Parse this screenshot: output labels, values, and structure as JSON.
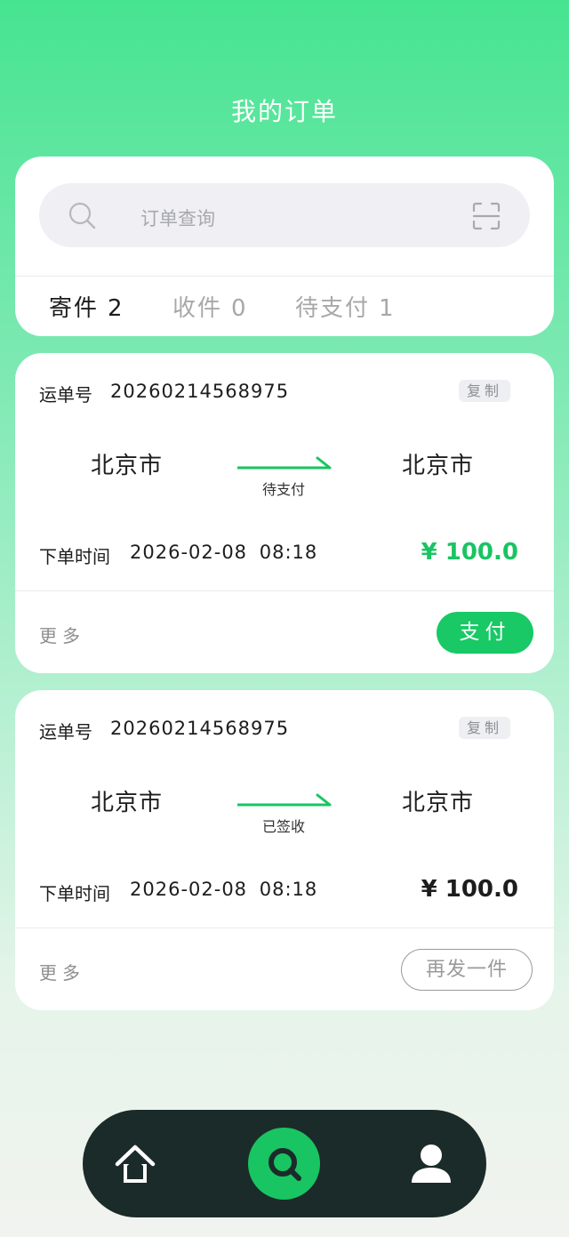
{
  "header": {
    "title": "我的订单"
  },
  "search": {
    "placeholder": "订单查询"
  },
  "tabs": [
    {
      "label": "寄件",
      "count": "2"
    },
    {
      "label": "收件",
      "count": "0"
    },
    {
      "label": "待支付",
      "count": "1"
    }
  ],
  "orders": [
    {
      "waybill_label": "运单号",
      "waybill_number": "20260214568975",
      "copy_label": "复制",
      "from_city": "北京市",
      "to_city": "北京市",
      "status": "待支付",
      "time_label": "下单时间",
      "time_value": "2026-02-08 08:18",
      "price": "¥ 100.0",
      "more_label": "更多",
      "action_label": "支付"
    },
    {
      "waybill_label": "运单号",
      "waybill_number": "20260214568975",
      "copy_label": "复制",
      "from_city": "北京市",
      "to_city": "北京市",
      "status": "已签收",
      "time_label": "下单时间",
      "time_value": "2026-02-08 08:18",
      "price": "¥ 100.0",
      "more_label": "更多",
      "action_label": "再发一件"
    }
  ],
  "nav": {
    "items": [
      {
        "icon": "home-icon"
      },
      {
        "icon": "search-icon"
      },
      {
        "icon": "user-icon"
      }
    ]
  },
  "colors": {
    "accent": "#19c462",
    "nav_background": "#1b2b29",
    "header_gradient_top": "#46e491"
  }
}
